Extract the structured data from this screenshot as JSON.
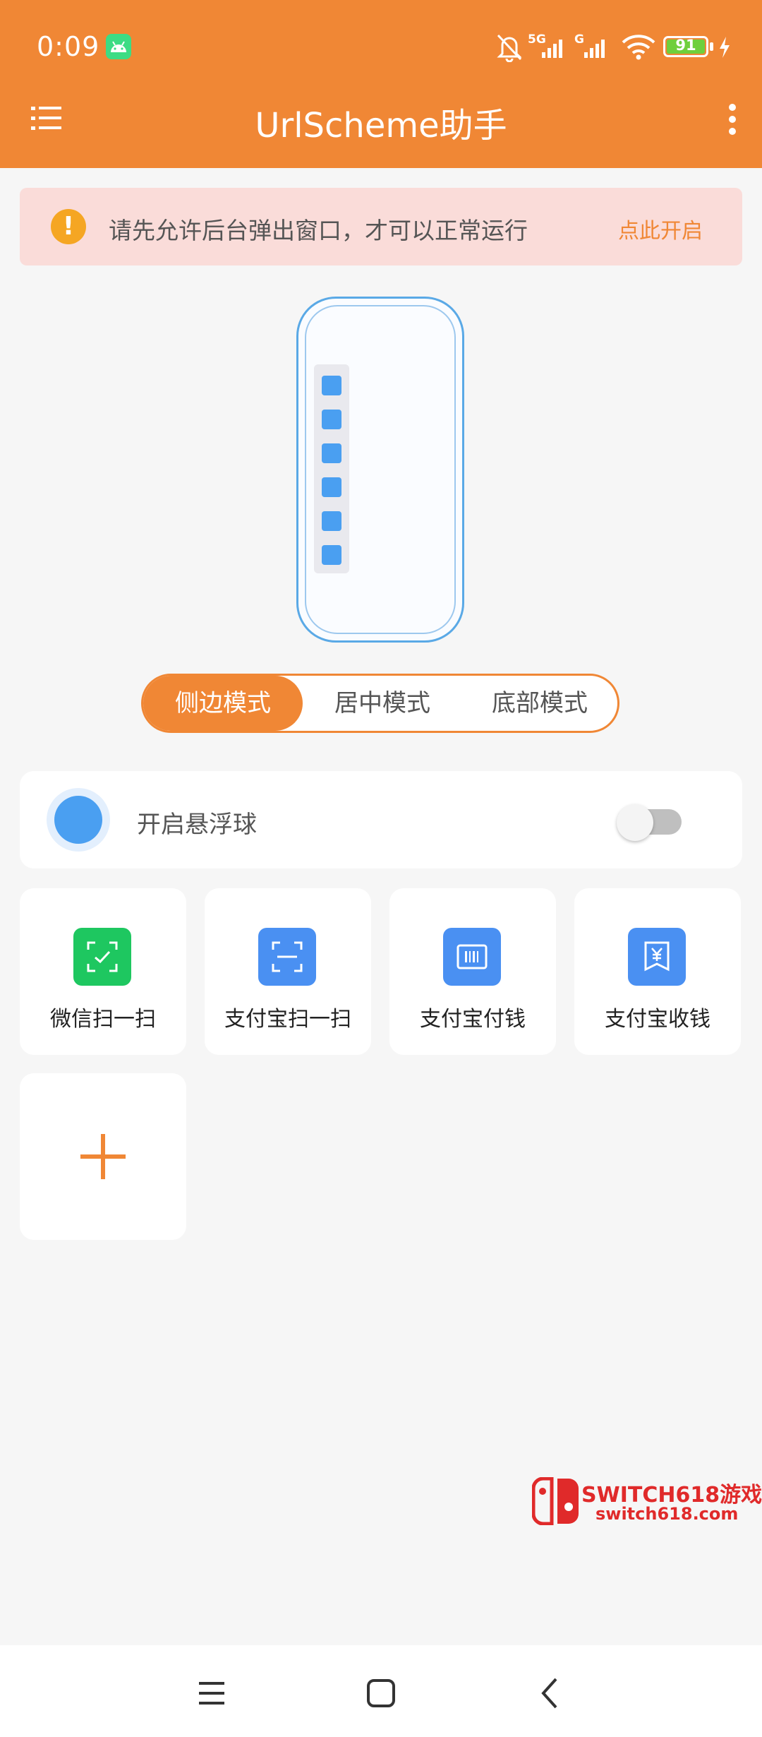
{
  "status_bar": {
    "time": "0:09",
    "battery": "91",
    "network_1": "5G",
    "network_2": "G"
  },
  "app_bar": {
    "title": "UrlScheme助手",
    "menu_icon": "list-icon",
    "more_icon": "more-vertical-icon"
  },
  "banner": {
    "icon": "warning-icon",
    "icon_glyph": "!",
    "text": "请先允许后台弹出窗口，才可以正常运行",
    "action": "点此开启"
  },
  "mode_selector": {
    "options": [
      "侧边模式",
      "居中模式",
      "底部模式"
    ],
    "selected": "侧边模式"
  },
  "float_ball": {
    "label": "开启悬浮球",
    "enabled": false
  },
  "shortcuts": [
    {
      "label": "微信扫一扫",
      "icon": "wechat-scan-icon",
      "color": "#1ec760"
    },
    {
      "label": "支付宝扫一扫",
      "icon": "alipay-scan-icon",
      "color": "#4a90f2"
    },
    {
      "label": "支付宝付钱",
      "icon": "alipay-pay-icon",
      "color": "#4a90f2"
    },
    {
      "label": "支付宝收钱",
      "icon": "alipay-receive-icon",
      "color": "#4a90f2"
    }
  ],
  "add_button": {
    "icon": "plus-icon"
  },
  "watermark": {
    "line1": "SWITCH618游戏",
    "line2": "switch618.com"
  },
  "colors": {
    "accent": "#f08735",
    "blue": "#4a9ff1",
    "wechat": "#1ec760"
  }
}
